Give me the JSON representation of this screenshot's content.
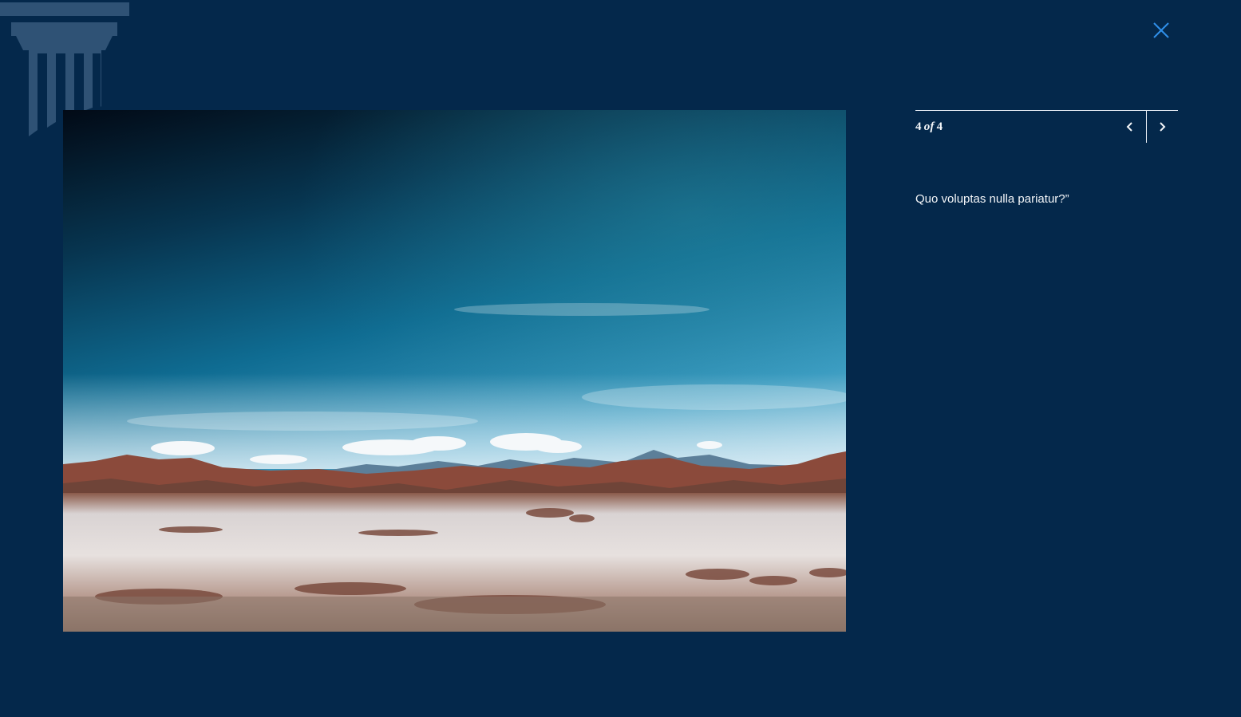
{
  "logo": {
    "icon": "column-pillar-icon",
    "color": "#2f5275"
  },
  "close": {
    "icon": "close-icon",
    "color": "#2f8fe8"
  },
  "gallery": {
    "current": "4",
    "of_label": "of",
    "total": "4",
    "prev_icon": "chevron-left-icon",
    "next_icon": "chevron-right-icon",
    "caption": "Quo voluptas nulla pariatur?”"
  },
  "colors": {
    "background": "#04284b",
    "text": "#f4f6f9",
    "rule": "#e8eef5"
  }
}
